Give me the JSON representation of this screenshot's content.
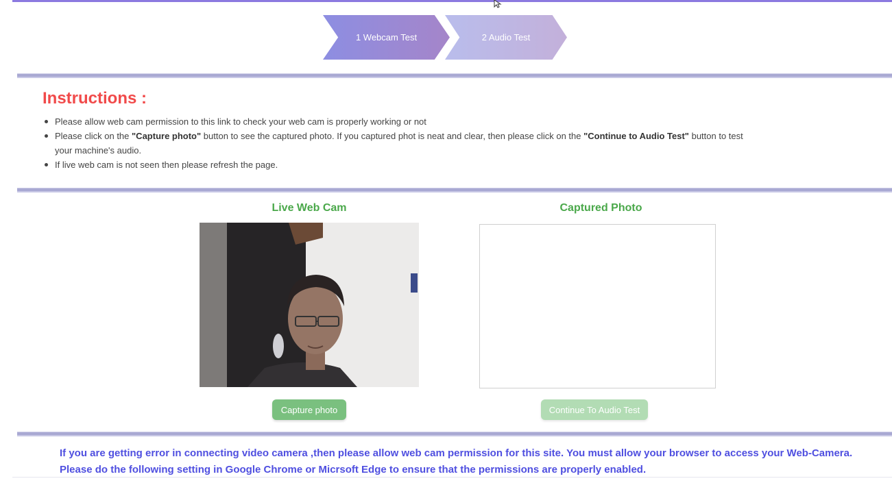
{
  "steps": [
    {
      "label": "1 Webcam Test",
      "active": true
    },
    {
      "label": "2 Audio Test",
      "active": false
    }
  ],
  "instructions": {
    "title": "Instructions :",
    "items": [
      {
        "text": "Please allow web cam permission to this link to check your web cam is properly working or not"
      },
      {
        "pre": "Please click on the ",
        "bold1": "\"Capture photo\"",
        "mid": " button to see the captured photo. If you captured phot is neat and clear, then please click on the ",
        "bold2": "\"Continue to Audio Test\"",
        "post": " button to test your machine's audio."
      },
      {
        "text": "If live web cam is not seen then please refresh the page."
      }
    ]
  },
  "webcam": {
    "title": "Live Web Cam",
    "capture_label": "Capture photo"
  },
  "captured": {
    "title": "Captured Photo",
    "continue_label": "Continue To Audio Test"
  },
  "error": {
    "line1": "If you are getting error in connecting video camera ,then please allow web cam permission for this site. You must allow your browser to access your Web-Camera.",
    "line2": "Please do the following setting in Google Chrome or Micrsoft Edge to ensure that the permissions are properly enabled."
  },
  "colors": {
    "accent": "#8b79e0",
    "title_red": "#f14a4a",
    "section_green": "#4aa84a",
    "button_green": "#7ac07f",
    "error_blue": "#4f4fe0"
  }
}
